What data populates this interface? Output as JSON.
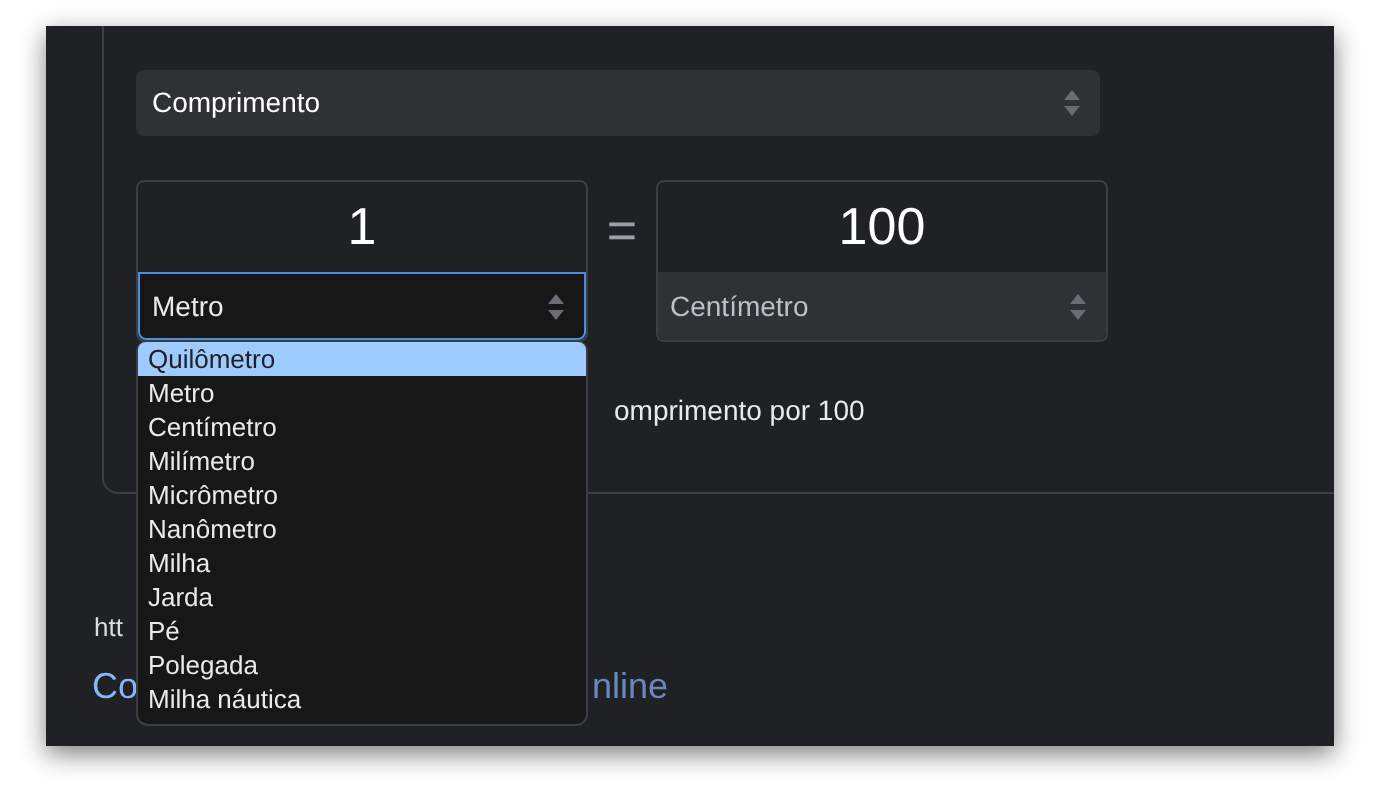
{
  "category_select": {
    "value": "Comprimento"
  },
  "from": {
    "value": "1",
    "unit": "Metro",
    "focused": true
  },
  "equals": "=",
  "to": {
    "value": "100",
    "unit": "Centímetro",
    "focused": false
  },
  "dropdown": {
    "options": [
      {
        "label": "Quilômetro",
        "selected": true
      },
      {
        "label": "Metro",
        "selected": false
      },
      {
        "label": "Centímetro",
        "selected": false
      },
      {
        "label": "Milímetro",
        "selected": false
      },
      {
        "label": "Micrômetro",
        "selected": false
      },
      {
        "label": "Nanômetro",
        "selected": false
      },
      {
        "label": "Milha",
        "selected": false
      },
      {
        "label": "Jarda",
        "selected": false
      },
      {
        "label": "Pé",
        "selected": false
      },
      {
        "label": "Polegada",
        "selected": false
      },
      {
        "label": "Milha náutica",
        "selected": false
      }
    ]
  },
  "formula": "omprimento por 100",
  "result": {
    "url": "htt",
    "title_start": "Co",
    "title_end": "nline"
  }
}
